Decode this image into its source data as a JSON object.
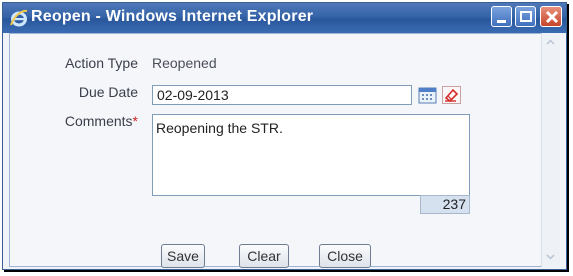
{
  "window": {
    "title": "Reopen - Windows Internet Explorer"
  },
  "form": {
    "action_type_label": "Action Type",
    "action_type_value": "Reopened",
    "due_date_label": "Due Date",
    "due_date_value": "02-09-2013",
    "comments_label": "Comments",
    "comments_required_mark": "*",
    "comments_value": "Reopening the STR.",
    "char_counter": "237"
  },
  "buttons": {
    "save": "Save",
    "clear": "Clear",
    "close": "Close"
  },
  "icons": {
    "window": "ie-logo-icon",
    "minimize": "minimize-icon",
    "maximize": "maximize-icon",
    "close": "close-icon",
    "calendar": "calendar-icon",
    "clear_date": "eraser-icon",
    "scroll_up": "scroll-up-icon",
    "scroll_down": "scroll-down-icon"
  },
  "colors": {
    "titlebar": "#3564a8",
    "required": "#cc2222",
    "close_button": "#c6452a"
  }
}
